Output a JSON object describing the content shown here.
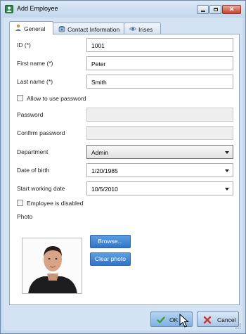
{
  "window": {
    "title": "Add Employee",
    "minimize_glyph": "",
    "maximize_glyph": "",
    "close_glyph": "✕"
  },
  "tabs": [
    {
      "label": "General",
      "icon": "user-icon"
    },
    {
      "label": "Contact Information",
      "icon": "phone-icon"
    },
    {
      "label": "Irises",
      "icon": "eye-icon"
    }
  ],
  "form": {
    "id": {
      "label": "ID (*)",
      "value": "1001"
    },
    "first_name": {
      "label": "First name (*)",
      "value": "Peter"
    },
    "last_name": {
      "label": "Last name (*)",
      "value": "Smith"
    },
    "allow_password": {
      "label": "Allow to use password",
      "checked": false
    },
    "password": {
      "label": "Password",
      "value": ""
    },
    "confirm_password": {
      "label": "Confirm password",
      "value": ""
    },
    "department": {
      "label": "Department",
      "value": "Admin"
    },
    "date_of_birth": {
      "label": "Date of birth",
      "value": "1/20/1985"
    },
    "start_working_date": {
      "label": "Start working date",
      "value": "10/5/2010"
    },
    "employee_disabled": {
      "label": "Employee is disabled",
      "checked": false
    },
    "photo": {
      "label": "Photo",
      "browse_label": "Browse...",
      "clear_label": "Clear photo"
    }
  },
  "footer": {
    "ok_label": "OK",
    "cancel_label": "Cancel"
  },
  "colors": {
    "accent": "#3a7fd0",
    "window_bg": "#d4e3f3",
    "ok_check": "#3a9a2a",
    "cancel_x": "#d0342c"
  }
}
